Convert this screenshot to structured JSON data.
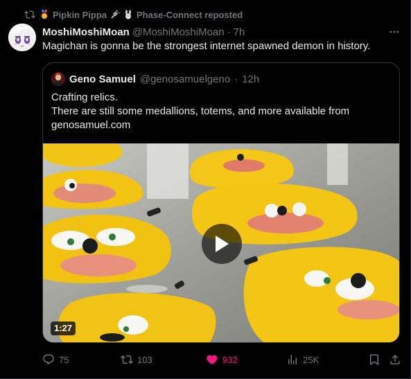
{
  "repost": {
    "icon": "retweet-icon",
    "name": "Pipkin Pippa",
    "extra_icons": [
      "medal-icon",
      "plug-icon",
      "bunny-icon"
    ],
    "by_suffix": "Phase-Connect reposted"
  },
  "post": {
    "display_name": "MoshiMoshiMoan",
    "handle": "@MoshiMoshiMoan",
    "separator": "·",
    "time": "7h",
    "text": "Magichan is gonna be the strongest internet spawned demon in history."
  },
  "quote": {
    "display_name": "Geno Samuel",
    "handle": "@genosamuelgeno",
    "separator": "·",
    "time": "12h",
    "lines": [
      "Crafting relics.",
      "There are still some medallions, totems, and more available from",
      "genosamuel.com"
    ],
    "media": {
      "type": "video",
      "duration": "1:27"
    }
  },
  "actions": {
    "replies": "75",
    "reposts": "103",
    "likes": "932",
    "views": "25K"
  },
  "colors": {
    "background": "#000000",
    "text": "#e7e9ea",
    "muted": "#71767b",
    "like": "#f91880",
    "border": "#2f3336"
  }
}
